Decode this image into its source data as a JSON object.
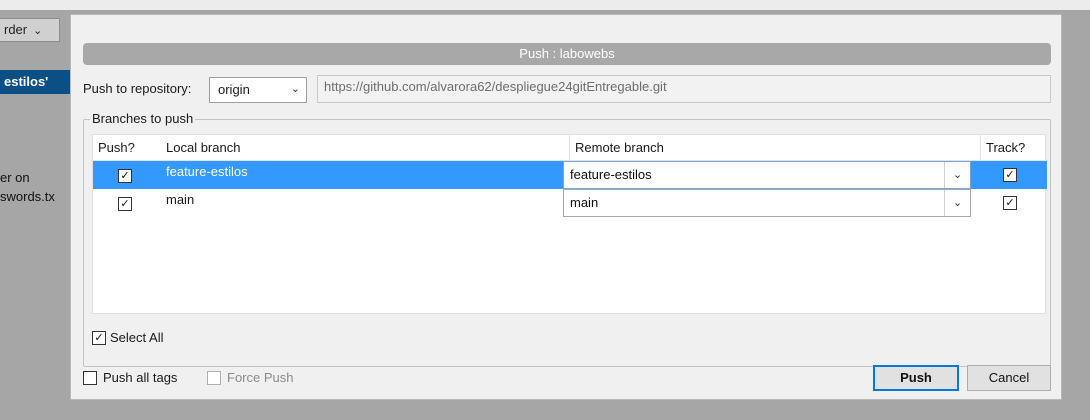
{
  "background": {
    "select_label": "rder",
    "selected_row_text": "estilos'",
    "text_line1": "er on",
    "text_line2": "swords.tx"
  },
  "dialog": {
    "title": "Push : labowebs",
    "repository": {
      "label": "Push to repository:",
      "selected": "origin",
      "url": "https://github.com/alvarora62/despliegue24gitEntregable.git"
    },
    "branches": {
      "group_title": "Branches to push",
      "columns": {
        "push": "Push?",
        "local": "Local branch",
        "remote": "Remote branch",
        "track": "Track?"
      },
      "rows": [
        {
          "push": true,
          "local": "feature-estilos",
          "remote": "feature-estilos",
          "track": true,
          "selected": true
        },
        {
          "push": true,
          "local": "main",
          "remote": "main",
          "track": true,
          "selected": false
        }
      ],
      "select_all_label": "Select All"
    },
    "options": {
      "push_all_tags": "Push all tags",
      "force_push": "Force Push"
    },
    "buttons": {
      "push": "Push",
      "cancel": "Cancel"
    },
    "check_glyph": "✓",
    "colors": {
      "selection": "#3399ff",
      "default_button_border": "#0078d7",
      "title_bar": "#a8a8a8"
    }
  }
}
